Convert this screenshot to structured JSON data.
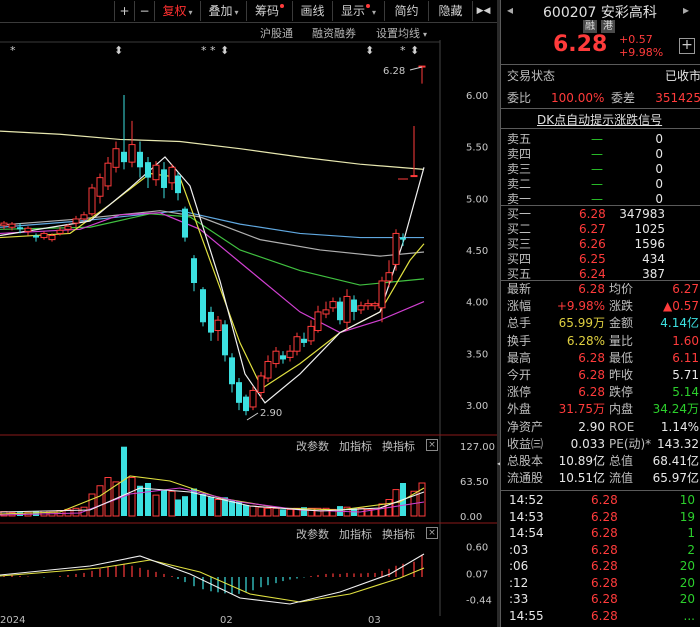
{
  "toolbar": {
    "plus": "+",
    "minus": "−",
    "adjust": "复权",
    "overlay": "叠加",
    "chips": "筹码",
    "draw": "画线",
    "display": "显示",
    "brief": "简约",
    "hide": "隐藏",
    "arrows": "▶◀"
  },
  "subheader": {
    "hgt": "沪股通",
    "margin": "融资融券",
    "ma_settings": "设置均线"
  },
  "main_chart": {
    "price_labels": [
      "6.00",
      "5.50",
      "5.00",
      "4.50",
      "4.00",
      "3.50",
      "3.00"
    ],
    "high_label": "6.28",
    "low_label": "2.90"
  },
  "volume_panel": {
    "change_params": "改参数",
    "add_indicator": "加指标",
    "switch_indicator": "换指标",
    "close": "×",
    "labels": [
      "127.00",
      "63.50",
      "0.00"
    ]
  },
  "macd_panel": {
    "change_params": "改参数",
    "add_indicator": "加指标",
    "switch_indicator": "换指标",
    "close": "×",
    "labels": [
      "0.60",
      "0.07",
      "-0.44"
    ]
  },
  "date_axis": [
    "2024",
    "02",
    "03"
  ],
  "quote": {
    "code": "600207",
    "name": "安彩高科",
    "badge1": "融",
    "badge2": "港",
    "price": "6.28",
    "change": "+0.57",
    "change_pct": "+9.98%",
    "status_label": "交易状态",
    "status_value": "已收市",
    "weibi_label": "委比",
    "weibi_value": "100.00%",
    "weicha_label": "委差",
    "weicha_value": "351425",
    "dk_banner": "DK点自动提示涨跌信号"
  },
  "asks": [
    {
      "label": "卖五",
      "price": "—",
      "vol": "0"
    },
    {
      "label": "卖四",
      "price": "—",
      "vol": "0"
    },
    {
      "label": "卖三",
      "price": "—",
      "vol": "0"
    },
    {
      "label": "卖二",
      "price": "—",
      "vol": "0"
    },
    {
      "label": "卖一",
      "price": "—",
      "vol": "0"
    }
  ],
  "bids": [
    {
      "label": "买一",
      "price": "6.28",
      "vol": "347983"
    },
    {
      "label": "买二",
      "price": "6.27",
      "vol": "1025"
    },
    {
      "label": "买三",
      "price": "6.26",
      "vol": "1596"
    },
    {
      "label": "买四",
      "price": "6.25",
      "vol": "434"
    },
    {
      "label": "买五",
      "price": "6.24",
      "vol": "387"
    }
  ],
  "stats": [
    {
      "l1": "最新",
      "v1": "6.28",
      "c1": "red",
      "l2": "均价",
      "v2": "6.27",
      "c2": "red"
    },
    {
      "l1": "涨幅",
      "v1": "+9.98%",
      "c1": "red",
      "l2": "涨跌",
      "v2": "▲0.57",
      "c2": "red"
    },
    {
      "l1": "总手",
      "v1": "65.99万",
      "c1": "yellow",
      "l2": "金额",
      "v2": "4.14亿",
      "c2": "cyan"
    },
    {
      "l1": "换手",
      "v1": "6.28%",
      "c1": "yellow",
      "l2": "量比",
      "v2": "1.60",
      "c2": "red"
    },
    {
      "l1": "最高",
      "v1": "6.28",
      "c1": "red",
      "l2": "最低",
      "v2": "6.11",
      "c2": "red"
    },
    {
      "l1": "今开",
      "v1": "6.28",
      "c1": "red",
      "l2": "昨收",
      "v2": "5.71",
      "c2": "white"
    },
    {
      "l1": "涨停",
      "v1": "6.28",
      "c1": "red",
      "l2": "跌停",
      "v2": "5.14",
      "c2": "green"
    },
    {
      "l1": "外盘",
      "v1": "31.75万",
      "c1": "red",
      "l2": "内盘",
      "v2": "34.24万",
      "c2": "green"
    },
    {
      "l1": "净资产",
      "v1": "2.90",
      "c1": "white",
      "l2": "ROE",
      "v2": "1.14%",
      "c2": "white"
    },
    {
      "l1": "收益㈢",
      "v1": "0.033",
      "c1": "white",
      "l2": "PE(动)*",
      "v2": "143.32",
      "c2": "white"
    },
    {
      "l1": "总股本",
      "v1": "10.89亿",
      "c1": "white",
      "l2": "总值",
      "v2": "68.41亿",
      "c2": "white"
    },
    {
      "l1": "流通股",
      "v1": "10.51亿",
      "c1": "white",
      "l2": "流值",
      "v2": "65.97亿",
      "c2": "white"
    }
  ],
  "ticks": [
    {
      "time": "14:52",
      "price": "6.28",
      "vol": "10"
    },
    {
      "time": "14:53",
      "price": "6.28",
      "vol": "19"
    },
    {
      "time": "14:54",
      "price": "6.28",
      "vol": "1"
    },
    {
      "time": ":03",
      "price": "6.28",
      "vol": "2"
    },
    {
      "time": ":06",
      "price": "6.28",
      "vol": "20"
    },
    {
      "time": ":12",
      "price": "6.28",
      "vol": "20"
    },
    {
      "time": ":33",
      "price": "6.28",
      "vol": "20"
    },
    {
      "time": "14:55",
      "price": "6.28",
      "vol": "..."
    }
  ]
}
